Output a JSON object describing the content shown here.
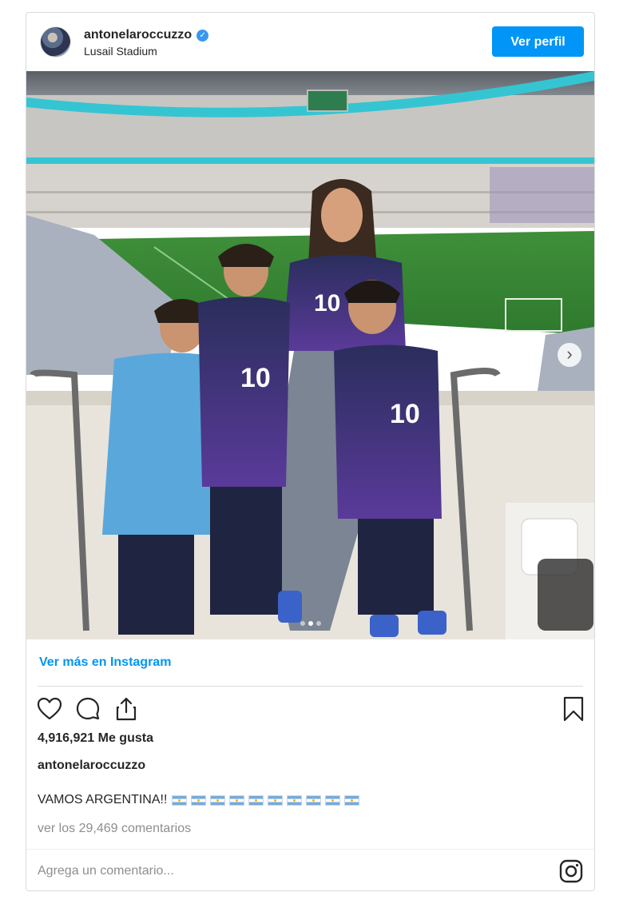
{
  "header": {
    "username": "antonelaroccuzzo",
    "verified_icon": "verified-badge-icon",
    "location": "Lusail Stadium",
    "view_profile_label": "Ver perfil"
  },
  "photo": {
    "next_icon": "chevron-right-icon",
    "jersey_number": "10",
    "carousel_total": 3,
    "carousel_active": 2
  },
  "view_more_label": "Ver más en Instagram",
  "actions": {
    "icons": [
      "heart-icon",
      "comment-icon",
      "share-icon",
      "bookmark-icon"
    ]
  },
  "likes_text": "4,916,921 Me gusta",
  "caption": {
    "owner": "antonelaroccuzzo",
    "text": "VAMOS ARGENTINA!!",
    "flag_count": 10
  },
  "comments_link": "ver los 29,469 comentarios",
  "comment_input": {
    "placeholder": "Agrega un comentario..."
  },
  "colors": {
    "accent": "#0095f6",
    "border": "#dbdbdb",
    "muted": "#8e8e8e"
  }
}
